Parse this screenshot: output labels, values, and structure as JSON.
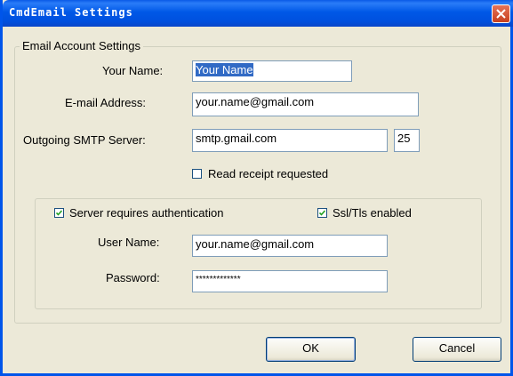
{
  "window": {
    "title": "CmdEmail Settings"
  },
  "email_group": {
    "legend": "Email Account Settings",
    "your_name_label": "Your Name:",
    "your_name_value": "Your Name",
    "email_label": "E-mail Address:",
    "email_value": "your.name@gmail.com",
    "smtp_label": "Outgoing SMTP Server:",
    "smtp_value": "smtp.gmail.com",
    "port_value": "25",
    "read_receipt_label": "Read receipt requested",
    "read_receipt_checked": false
  },
  "auth_group": {
    "server_auth_label": "Server requires authentication",
    "server_auth_checked": true,
    "ssl_label": "Ssl/Tls enabled",
    "ssl_checked": true,
    "username_label": "User Name:",
    "username_value": "your.name@gmail.com",
    "password_label": "Password:",
    "password_value": "*************"
  },
  "buttons": {
    "ok": "OK",
    "cancel": "Cancel"
  }
}
